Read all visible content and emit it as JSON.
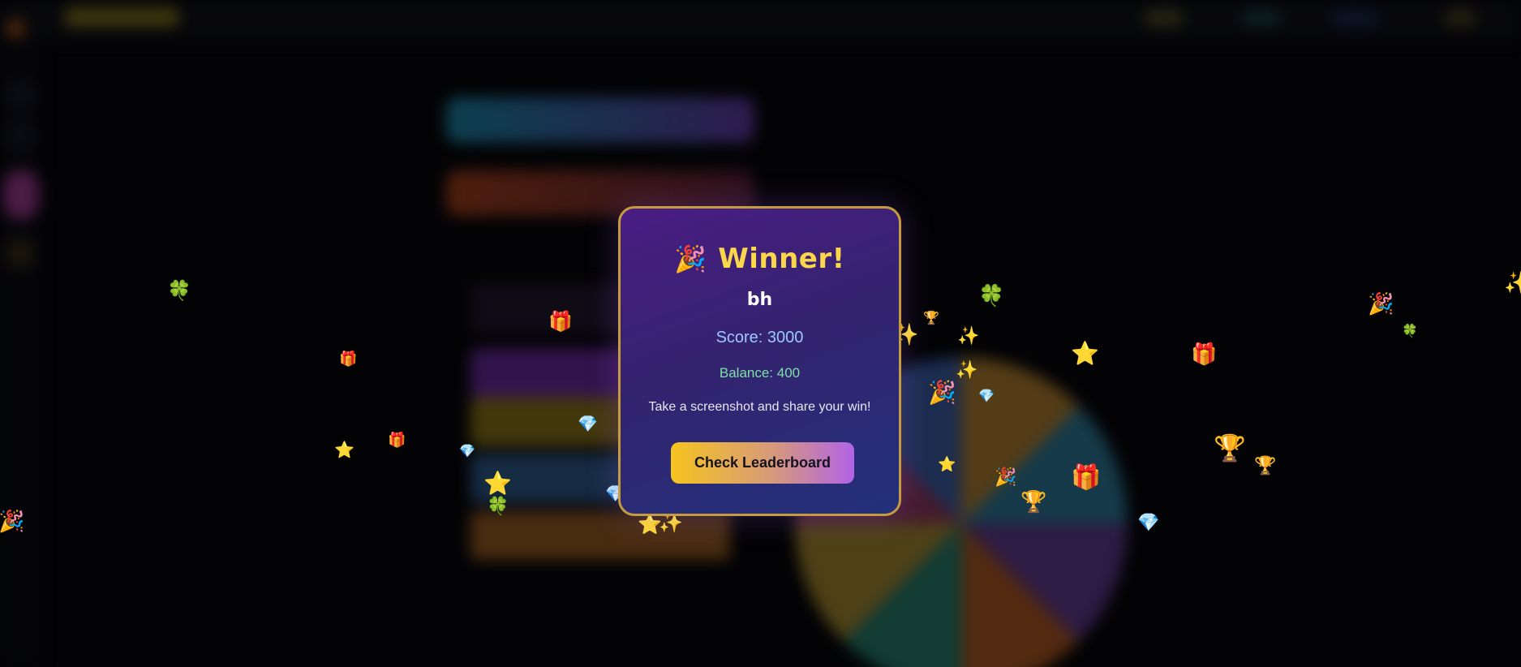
{
  "modal": {
    "party_icon": "🎉",
    "title": "Winner!",
    "player_name": "bh",
    "score_text": "Score: 3000",
    "balance_text": "Balance: 400",
    "share_text": "Take a screenshot and share your win!",
    "leaderboard_button": "Check Leaderboard"
  },
  "confetti_glyphs": {
    "clover": "🍀",
    "gift": "🎁",
    "star": "⭐",
    "gem": "💎",
    "party": "🎉",
    "sparkles": "✨",
    "trophy": "🏆"
  },
  "colors": {
    "modal_border": "#c69a3e",
    "title": "#f9d64a",
    "score": "#9ec7ff",
    "balance": "#7ee0a6",
    "button_start": "#f6c41f",
    "button_end": "#b163e6"
  }
}
